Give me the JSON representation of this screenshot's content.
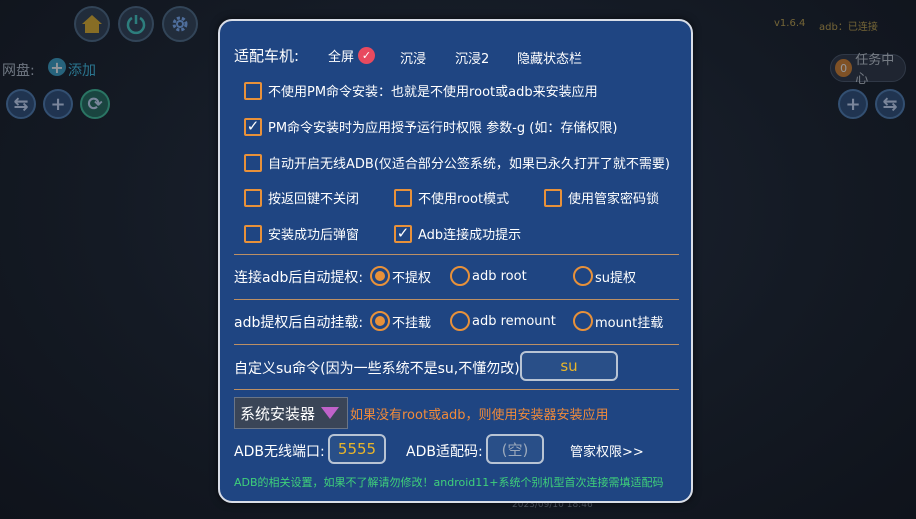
{
  "background": {
    "netdisk_label": "网盘:",
    "add_label": "添加",
    "version": "v1.6.4",
    "adb_status": "adb：已连接",
    "task_center": "任务中心",
    "task_count": "0",
    "bottom_timestamp": "2023/09/10 18:46"
  },
  "dialog": {
    "car_adapt": {
      "label": "适配车机:",
      "options": [
        "全屏",
        "沉浸",
        "沉浸2",
        "隐藏状态栏"
      ],
      "selected": "全屏"
    },
    "checkboxes": [
      {
        "label": "不使用PM命令安装：也就是不使用root或adb来安装应用",
        "checked": false
      },
      {
        "label": "PM命令安装时为应用授予运行时权限 参数-g (如：存储权限)",
        "checked": true
      },
      {
        "label": "自动开启无线ADB(仅适合部分公签系统，如果已永久打开了就不需要)",
        "checked": false
      },
      {
        "label": "按返回键不关闭",
        "checked": false
      },
      {
        "label": "不使用root模式",
        "checked": false
      },
      {
        "label": "使用管家密码锁",
        "checked": false
      },
      {
        "label": "安装成功后弹窗",
        "checked": false
      },
      {
        "label": "Adb连接成功提示",
        "checked": true
      }
    ],
    "auto_grant": {
      "label": "连接adb后自动提权:",
      "options": [
        "不提权",
        "adb root",
        "su提权"
      ],
      "selected": "不提权"
    },
    "auto_mount": {
      "label": "adb提权后自动挂载:",
      "options": [
        "不挂载",
        "adb remount",
        "mount挂载"
      ],
      "selected": "不挂载"
    },
    "su_command": {
      "label": "自定义su命令(因为一些系统不是su,不懂勿改):",
      "value": "su"
    },
    "installer": {
      "selected": "系统安装器",
      "hint": "如果没有root或adb，则使用安装器安装应用"
    },
    "adb_port": {
      "label": "ADB无线端口:",
      "value": "5555"
    },
    "adb_pair": {
      "label": "ADB适配码:",
      "placeholder": "(空)"
    },
    "manager_permission_link": "管家权限>>",
    "footer_note": "ADB的相关设置，如果不了解请勿修改！android11+系统个别机型首次连接需填适配码"
  },
  "colors": {
    "dialog_bg": "#1f4582",
    "accent_orange": "#e8913a",
    "selected_red": "#e84a5f",
    "value_yellow": "#e8b52a",
    "footer_green": "#3fd07a"
  }
}
